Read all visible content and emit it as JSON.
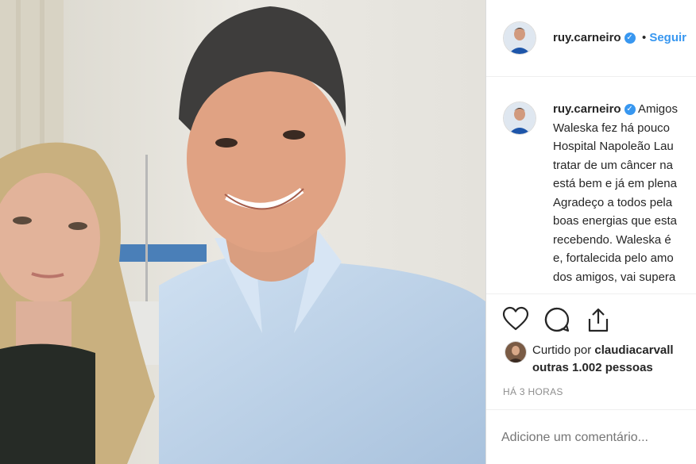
{
  "post": {
    "header": {
      "username": "ruy.carneiro",
      "separator": "•",
      "follow_label": "Seguir"
    },
    "caption": {
      "username": "ruy.carneiro",
      "lines": [
        "Amigos",
        "Waleska fez há pouco",
        "Hospital Napoleão Lau",
        "tratar de um câncer na",
        "está bem e já em plena",
        "Agradeço a todos pela",
        "boas energias que esta",
        "recebendo. Waleska é",
        "e, fortalecida pelo amo",
        "dos amigos, vai supera"
      ]
    },
    "likes": {
      "prefix": "Curtido por",
      "liker": "claudiacarvall",
      "others": "outras 1.002 pessoas"
    },
    "timestamp": "HÁ 3 HORAS",
    "comment_placeholder": "Adicione um comentário..."
  },
  "icons": {
    "verified": "verified-badge-icon",
    "like": "heart-icon",
    "comment": "comment-bubble-icon",
    "share": "share-upload-icon"
  },
  "colors": {
    "link_blue": "#3897f0",
    "text": "#262626",
    "muted": "#8e8e8e"
  }
}
